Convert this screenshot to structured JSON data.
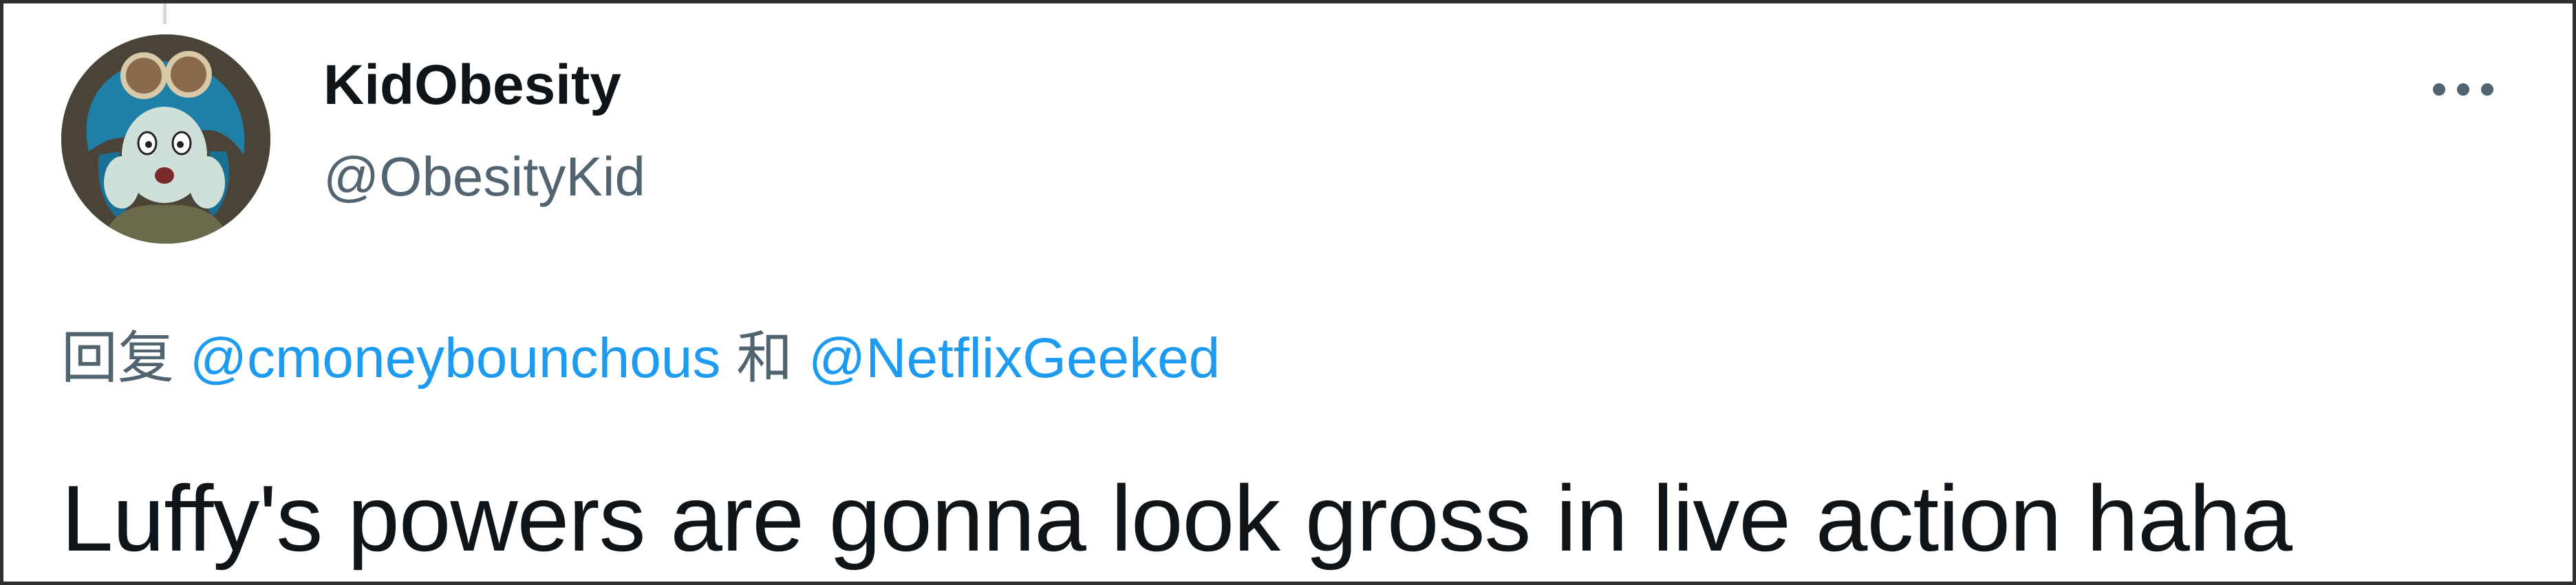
{
  "tweet": {
    "author": {
      "display_name": "KidObesity",
      "handle": "@ObesityKid",
      "avatar_icon": "avatar-image"
    },
    "more_icon": "more-horizontal-icon",
    "reply": {
      "prefix": "回复",
      "mentions": [
        "@cmoneybounchous",
        "@NetflixGeeked"
      ],
      "conjunction": "和"
    },
    "text": "Luffy's powers are gonna look gross in live action haha"
  },
  "colors": {
    "primary_text": "#0f1419",
    "secondary_text": "#536471",
    "link": "#1d9bf0",
    "border": "#2f2f2f"
  }
}
